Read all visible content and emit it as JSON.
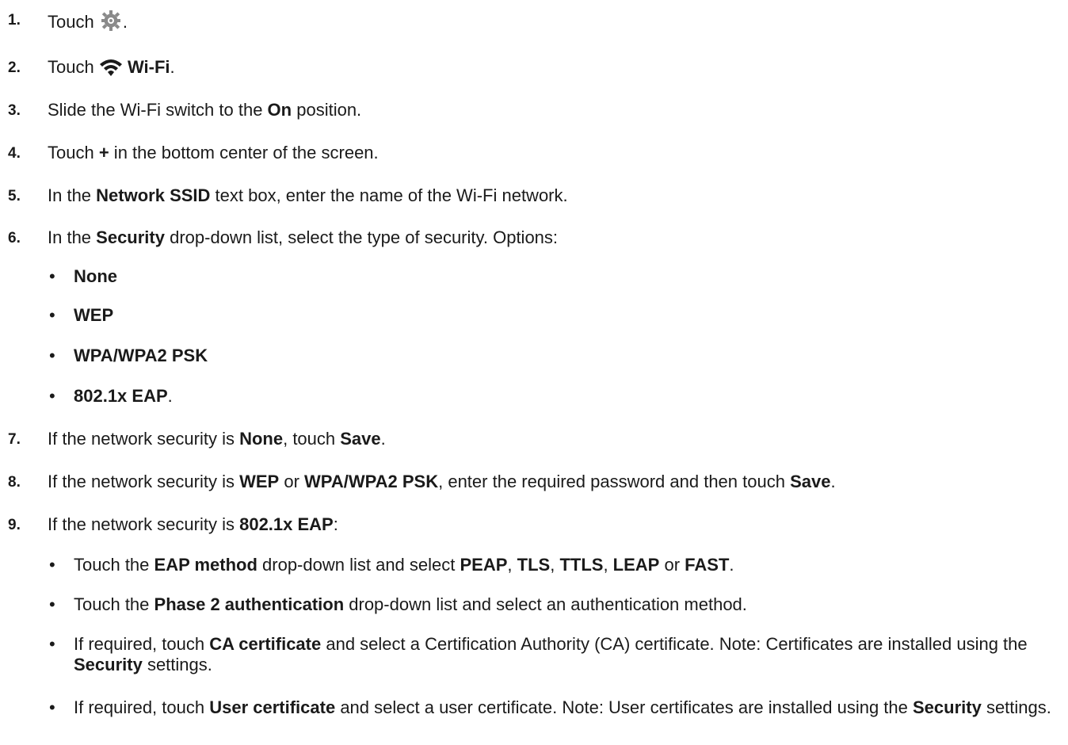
{
  "steps": [
    {
      "num": "1.",
      "parts": [
        {
          "t": "Touch "
        },
        {
          "icon": "settings-gear-icon"
        },
        {
          "t": "."
        }
      ]
    },
    {
      "num": "2.",
      "parts": [
        {
          "t": "Touch "
        },
        {
          "icon": "wifi-icon"
        },
        {
          "t": " "
        },
        {
          "b": "Wi-Fi"
        },
        {
          "t": "."
        }
      ]
    },
    {
      "num": "3.",
      "parts": [
        {
          "t": "Slide the Wi-Fi switch to the "
        },
        {
          "b": "On"
        },
        {
          "t": " position."
        }
      ]
    },
    {
      "num": "4.",
      "parts": [
        {
          "t": "Touch "
        },
        {
          "b": "+"
        },
        {
          "t": " in the bottom center of the screen."
        }
      ]
    },
    {
      "num": "5.",
      "parts": [
        {
          "t": "In the "
        },
        {
          "b": "Network SSID"
        },
        {
          "t": " text box, enter the name of the Wi-Fi network."
        }
      ]
    },
    {
      "num": "6.",
      "parts": [
        {
          "t": "In the "
        },
        {
          "b": "Security"
        },
        {
          "t": " drop-down list, select the type of security. Options:"
        }
      ]
    },
    {
      "num": "7.",
      "parts": [
        {
          "t": "If the network security is "
        },
        {
          "b": "None"
        },
        {
          "t": ", touch "
        },
        {
          "b": "Save"
        },
        {
          "t": "."
        }
      ]
    },
    {
      "num": "8.",
      "parts": [
        {
          "t": "If the network security is "
        },
        {
          "b": "WEP"
        },
        {
          "t": " or "
        },
        {
          "b": "WPA/WPA2 PSK"
        },
        {
          "t": ", enter the required password and then touch "
        },
        {
          "b": "Save"
        },
        {
          "t": "."
        }
      ]
    },
    {
      "num": "9.",
      "parts": [
        {
          "t": "If the network security is "
        },
        {
          "b": "802.1x EAP"
        },
        {
          "t": ":"
        }
      ]
    }
  ],
  "security_options": [
    {
      "parts": [
        {
          "b": "None"
        }
      ]
    },
    {
      "parts": [
        {
          "b": "WEP"
        }
      ]
    },
    {
      "parts": [
        {
          "b": "WPA/WPA2 PSK"
        }
      ]
    },
    {
      "parts": [
        {
          "b": "802.1x EAP"
        },
        {
          "t": "."
        }
      ]
    }
  ],
  "eap_bullets": [
    {
      "parts": [
        {
          "t": "Touch the "
        },
        {
          "b": "EAP method"
        },
        {
          "t": " drop-down list and select "
        },
        {
          "b": "PEAP"
        },
        {
          "t": ", "
        },
        {
          "b": "TLS"
        },
        {
          "t": ", "
        },
        {
          "b": "TTLS"
        },
        {
          "t": ", "
        },
        {
          "b": "LEAP"
        },
        {
          "t": " or "
        },
        {
          "b": "FAST"
        },
        {
          "t": "."
        }
      ]
    },
    {
      "parts": [
        {
          "t": "Touch the "
        },
        {
          "b": "Phase 2 authentication"
        },
        {
          "t": " drop-down list and select an authentication method."
        }
      ]
    },
    {
      "parts": [
        {
          "t": "If required, touch "
        },
        {
          "b": "CA certificate"
        },
        {
          "t": " and select a Certification Authority (CA) certificate. Note: Certificates are installed using the "
        },
        {
          "b": "Security"
        },
        {
          "t": " settings."
        }
      ]
    },
    {
      "parts": [
        {
          "t": "If required, touch "
        },
        {
          "b": "User certificate"
        },
        {
          "t": " and select a user certificate. Note: User certificates are installed using the "
        },
        {
          "b": "Security"
        },
        {
          "t": " settings."
        }
      ]
    }
  ],
  "bullet_char": "•",
  "colors": {
    "text": "#1a1a1a",
    "icon": "#8a8a8a"
  }
}
